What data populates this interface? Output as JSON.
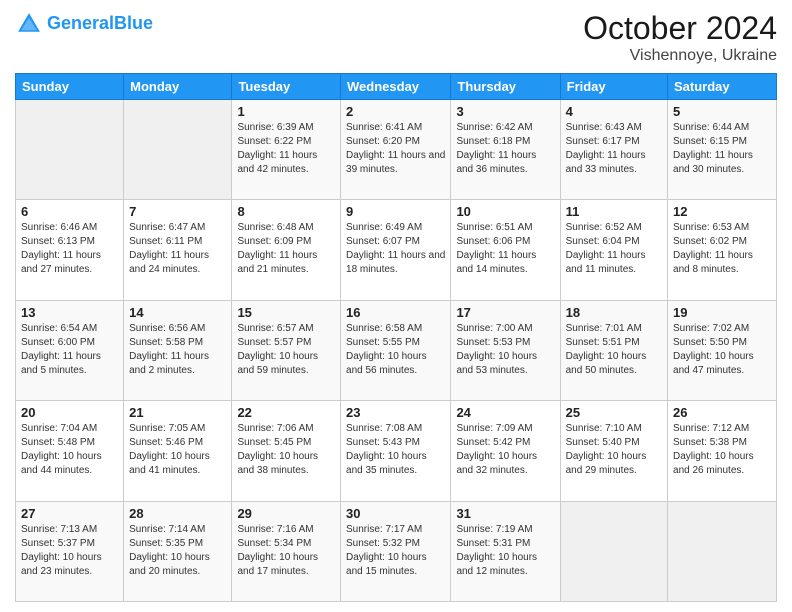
{
  "header": {
    "logo": "GeneralBlue",
    "logo_general": "General",
    "logo_blue": "Blue",
    "month": "October 2024",
    "location": "Vishennoye, Ukraine"
  },
  "days_of_week": [
    "Sunday",
    "Monday",
    "Tuesday",
    "Wednesday",
    "Thursday",
    "Friday",
    "Saturday"
  ],
  "weeks": [
    [
      {
        "day": "",
        "sunrise": "",
        "sunset": "",
        "daylight": ""
      },
      {
        "day": "",
        "sunrise": "",
        "sunset": "",
        "daylight": ""
      },
      {
        "day": "1",
        "sunrise": "Sunrise: 6:39 AM",
        "sunset": "Sunset: 6:22 PM",
        "daylight": "Daylight: 11 hours and 42 minutes."
      },
      {
        "day": "2",
        "sunrise": "Sunrise: 6:41 AM",
        "sunset": "Sunset: 6:20 PM",
        "daylight": "Daylight: 11 hours and 39 minutes."
      },
      {
        "day": "3",
        "sunrise": "Sunrise: 6:42 AM",
        "sunset": "Sunset: 6:18 PM",
        "daylight": "Daylight: 11 hours and 36 minutes."
      },
      {
        "day": "4",
        "sunrise": "Sunrise: 6:43 AM",
        "sunset": "Sunset: 6:17 PM",
        "daylight": "Daylight: 11 hours and 33 minutes."
      },
      {
        "day": "5",
        "sunrise": "Sunrise: 6:44 AM",
        "sunset": "Sunset: 6:15 PM",
        "daylight": "Daylight: 11 hours and 30 minutes."
      }
    ],
    [
      {
        "day": "6",
        "sunrise": "Sunrise: 6:46 AM",
        "sunset": "Sunset: 6:13 PM",
        "daylight": "Daylight: 11 hours and 27 minutes."
      },
      {
        "day": "7",
        "sunrise": "Sunrise: 6:47 AM",
        "sunset": "Sunset: 6:11 PM",
        "daylight": "Daylight: 11 hours and 24 minutes."
      },
      {
        "day": "8",
        "sunrise": "Sunrise: 6:48 AM",
        "sunset": "Sunset: 6:09 PM",
        "daylight": "Daylight: 11 hours and 21 minutes."
      },
      {
        "day": "9",
        "sunrise": "Sunrise: 6:49 AM",
        "sunset": "Sunset: 6:07 PM",
        "daylight": "Daylight: 11 hours and 18 minutes."
      },
      {
        "day": "10",
        "sunrise": "Sunrise: 6:51 AM",
        "sunset": "Sunset: 6:06 PM",
        "daylight": "Daylight: 11 hours and 14 minutes."
      },
      {
        "day": "11",
        "sunrise": "Sunrise: 6:52 AM",
        "sunset": "Sunset: 6:04 PM",
        "daylight": "Daylight: 11 hours and 11 minutes."
      },
      {
        "day": "12",
        "sunrise": "Sunrise: 6:53 AM",
        "sunset": "Sunset: 6:02 PM",
        "daylight": "Daylight: 11 hours and 8 minutes."
      }
    ],
    [
      {
        "day": "13",
        "sunrise": "Sunrise: 6:54 AM",
        "sunset": "Sunset: 6:00 PM",
        "daylight": "Daylight: 11 hours and 5 minutes."
      },
      {
        "day": "14",
        "sunrise": "Sunrise: 6:56 AM",
        "sunset": "Sunset: 5:58 PM",
        "daylight": "Daylight: 11 hours and 2 minutes."
      },
      {
        "day": "15",
        "sunrise": "Sunrise: 6:57 AM",
        "sunset": "Sunset: 5:57 PM",
        "daylight": "Daylight: 10 hours and 59 minutes."
      },
      {
        "day": "16",
        "sunrise": "Sunrise: 6:58 AM",
        "sunset": "Sunset: 5:55 PM",
        "daylight": "Daylight: 10 hours and 56 minutes."
      },
      {
        "day": "17",
        "sunrise": "Sunrise: 7:00 AM",
        "sunset": "Sunset: 5:53 PM",
        "daylight": "Daylight: 10 hours and 53 minutes."
      },
      {
        "day": "18",
        "sunrise": "Sunrise: 7:01 AM",
        "sunset": "Sunset: 5:51 PM",
        "daylight": "Daylight: 10 hours and 50 minutes."
      },
      {
        "day": "19",
        "sunrise": "Sunrise: 7:02 AM",
        "sunset": "Sunset: 5:50 PM",
        "daylight": "Daylight: 10 hours and 47 minutes."
      }
    ],
    [
      {
        "day": "20",
        "sunrise": "Sunrise: 7:04 AM",
        "sunset": "Sunset: 5:48 PM",
        "daylight": "Daylight: 10 hours and 44 minutes."
      },
      {
        "day": "21",
        "sunrise": "Sunrise: 7:05 AM",
        "sunset": "Sunset: 5:46 PM",
        "daylight": "Daylight: 10 hours and 41 minutes."
      },
      {
        "day": "22",
        "sunrise": "Sunrise: 7:06 AM",
        "sunset": "Sunset: 5:45 PM",
        "daylight": "Daylight: 10 hours and 38 minutes."
      },
      {
        "day": "23",
        "sunrise": "Sunrise: 7:08 AM",
        "sunset": "Sunset: 5:43 PM",
        "daylight": "Daylight: 10 hours and 35 minutes."
      },
      {
        "day": "24",
        "sunrise": "Sunrise: 7:09 AM",
        "sunset": "Sunset: 5:42 PM",
        "daylight": "Daylight: 10 hours and 32 minutes."
      },
      {
        "day": "25",
        "sunrise": "Sunrise: 7:10 AM",
        "sunset": "Sunset: 5:40 PM",
        "daylight": "Daylight: 10 hours and 29 minutes."
      },
      {
        "day": "26",
        "sunrise": "Sunrise: 7:12 AM",
        "sunset": "Sunset: 5:38 PM",
        "daylight": "Daylight: 10 hours and 26 minutes."
      }
    ],
    [
      {
        "day": "27",
        "sunrise": "Sunrise: 7:13 AM",
        "sunset": "Sunset: 5:37 PM",
        "daylight": "Daylight: 10 hours and 23 minutes."
      },
      {
        "day": "28",
        "sunrise": "Sunrise: 7:14 AM",
        "sunset": "Sunset: 5:35 PM",
        "daylight": "Daylight: 10 hours and 20 minutes."
      },
      {
        "day": "29",
        "sunrise": "Sunrise: 7:16 AM",
        "sunset": "Sunset: 5:34 PM",
        "daylight": "Daylight: 10 hours and 17 minutes."
      },
      {
        "day": "30",
        "sunrise": "Sunrise: 7:17 AM",
        "sunset": "Sunset: 5:32 PM",
        "daylight": "Daylight: 10 hours and 15 minutes."
      },
      {
        "day": "31",
        "sunrise": "Sunrise: 7:19 AM",
        "sunset": "Sunset: 5:31 PM",
        "daylight": "Daylight: 10 hours and 12 minutes."
      },
      {
        "day": "",
        "sunrise": "",
        "sunset": "",
        "daylight": ""
      },
      {
        "day": "",
        "sunrise": "",
        "sunset": "",
        "daylight": ""
      }
    ]
  ]
}
